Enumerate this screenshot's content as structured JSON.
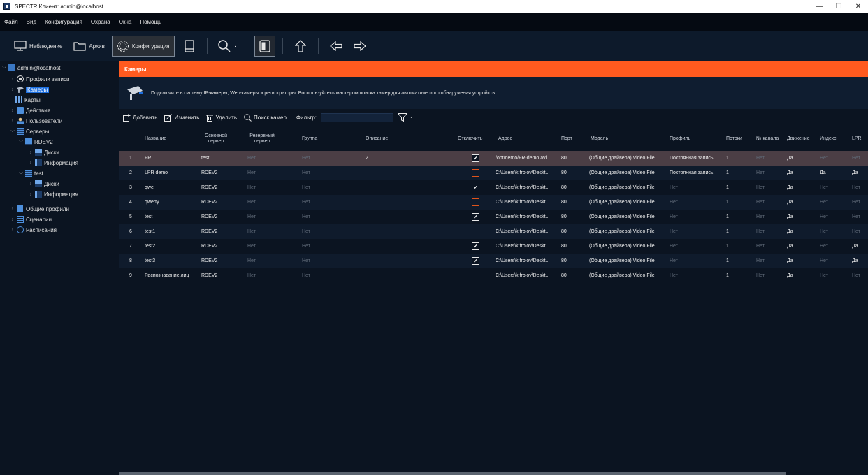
{
  "window": {
    "title": "SPECTR Клиент: admin@localhost",
    "controls": [
      "—",
      "❐",
      "✕"
    ]
  },
  "menu": [
    "Файл",
    "Вид",
    "Конфигурация",
    "Охрана",
    "Окна",
    "Помощь"
  ],
  "toolbar": {
    "monitor_label": "Наблюдение",
    "archive_label": "Архив",
    "config_label": "Конфигурация",
    "search_dropdown": "·"
  },
  "tree": {
    "root": "admin@localhost",
    "recording_profiles": "Профили записи",
    "cameras": "Камеры",
    "maps": "Карты",
    "actions": "Действия",
    "users": "Пользователи",
    "servers": "Серверы",
    "server1": "RDEV2",
    "server1_disks": "Диски",
    "server1_info": "Информация",
    "server2": "test",
    "server2_disks": "Диски",
    "server2_info": "Информация",
    "common_profiles": "Общие профили",
    "scenarios": "Сценарии",
    "schedules": "Расписания"
  },
  "panel": {
    "title": "Камеры",
    "info": "Подключите в систему IP-камеры, Web-камеры и регистраторы. Воспользуйтесь мастером поиска камер для автоматического обнаружения устройств."
  },
  "actions": {
    "add": "Добавить",
    "edit": "Изменить",
    "delete": "Удалить",
    "search": "Поиск камер",
    "filter_label": "Фильтр:",
    "filter_value": ""
  },
  "columns": {
    "name": "Название",
    "main_server": "Основной сервер",
    "backup_server": "Резервный сервер",
    "group": "Группа",
    "description": "Описание",
    "disable": "Отключить",
    "address": "Адрес",
    "port": "Порт",
    "model": "Модель",
    "profile": "Профиль",
    "streams": "Потоки",
    "channel": "№ канала",
    "motion": "Движение",
    "index": "Индекс",
    "lpr": "LPR"
  },
  "rows": [
    {
      "num": "1",
      "name": "FR",
      "main": "test",
      "backup": "Нет",
      "group": "Нет",
      "desc": "2",
      "disabled": true,
      "addr": "/opt/demo/FR-demo.avi",
      "port": "80",
      "model": "(Общие драйвера) Video File",
      "profile": "Постоянная запись",
      "streams": "1",
      "channel": "Нет",
      "motion": "Да",
      "index": "Нет",
      "lpr": "Нет"
    },
    {
      "num": "2",
      "name": "LPR demo",
      "main": "RDEV2",
      "backup": "Нет",
      "group": "Нет",
      "desc": "",
      "disabled": false,
      "addr": "C:\\Users\\k.frolov\\Deskt...",
      "port": "80",
      "model": "(Общие драйвера) Video File",
      "profile": "Постоянная запись",
      "streams": "1",
      "channel": "Нет",
      "motion": "Да",
      "index": "Да",
      "lpr": "Да"
    },
    {
      "num": "3",
      "name": "qwe",
      "main": "RDEV2",
      "backup": "Нет",
      "group": "Нет",
      "desc": "",
      "disabled": true,
      "addr": "C:\\Users\\k.frolov\\Deskt...",
      "port": "80",
      "model": "(Общие драйвера) Video File",
      "profile": "Нет",
      "streams": "1",
      "channel": "Нет",
      "motion": "Да",
      "index": "Нет",
      "lpr": "Нет"
    },
    {
      "num": "4",
      "name": "qwerty",
      "main": "RDEV2",
      "backup": "Нет",
      "group": "Нет",
      "desc": "",
      "disabled": false,
      "addr": "C:\\Users\\k.frolov\\Deskt...",
      "port": "80",
      "model": "(Общие драйвера) Video File",
      "profile": "Нет",
      "streams": "1",
      "channel": "Нет",
      "motion": "Да",
      "index": "Нет",
      "lpr": "Нет"
    },
    {
      "num": "5",
      "name": "test",
      "main": "RDEV2",
      "backup": "Нет",
      "group": "Нет",
      "desc": "",
      "disabled": true,
      "addr": "C:\\Users\\k.frolov\\Deskt...",
      "port": "80",
      "model": "(Общие драйвера) Video File",
      "profile": "Нет",
      "streams": "1",
      "channel": "Нет",
      "motion": "Да",
      "index": "Нет",
      "lpr": "Нет"
    },
    {
      "num": "6",
      "name": "test1",
      "main": "RDEV2",
      "backup": "Нет",
      "group": "Нет",
      "desc": "",
      "disabled": false,
      "addr": "C:\\Users\\k.frolov\\Deskt...",
      "port": "80",
      "model": "(Общие драйвера) Video File",
      "profile": "Нет",
      "streams": "1",
      "channel": "Нет",
      "motion": "Да",
      "index": "Нет",
      "lpr": "Нет"
    },
    {
      "num": "7",
      "name": "test2",
      "main": "RDEV2",
      "backup": "Нет",
      "group": "Нет",
      "desc": "",
      "disabled": true,
      "addr": "C:\\Users\\k.frolov\\Deskt...",
      "port": "80",
      "model": "(Общие драйвера) Video File",
      "profile": "Нет",
      "streams": "1",
      "channel": "Нет",
      "motion": "Да",
      "index": "Нет",
      "lpr": "Да"
    },
    {
      "num": "8",
      "name": "test3",
      "main": "RDEV2",
      "backup": "Нет",
      "group": "Нет",
      "desc": "",
      "disabled": true,
      "addr": "C:\\Users\\k.frolov\\Deskt...",
      "port": "80",
      "model": "(Общие драйвера) Video File",
      "profile": "Нет",
      "streams": "1",
      "channel": "Нет",
      "motion": "Да",
      "index": "Нет",
      "lpr": "Да"
    },
    {
      "num": "9",
      "name": "Распознавание лиц",
      "main": "RDEV2",
      "backup": "Нет",
      "group": "Нет",
      "desc": "",
      "disabled": false,
      "addr": "C:\\Users\\k.frolov\\Deskt...",
      "port": "80",
      "model": "(Общие драйвера) Video File",
      "profile": "Нет",
      "streams": "1",
      "channel": "Нет",
      "motion": "Да",
      "index": "Нет",
      "lpr": "Нет"
    }
  ],
  "colors": {
    "accent": "#ff5a1f",
    "selection": "#1d6fe0",
    "background": "#0b1421"
  }
}
